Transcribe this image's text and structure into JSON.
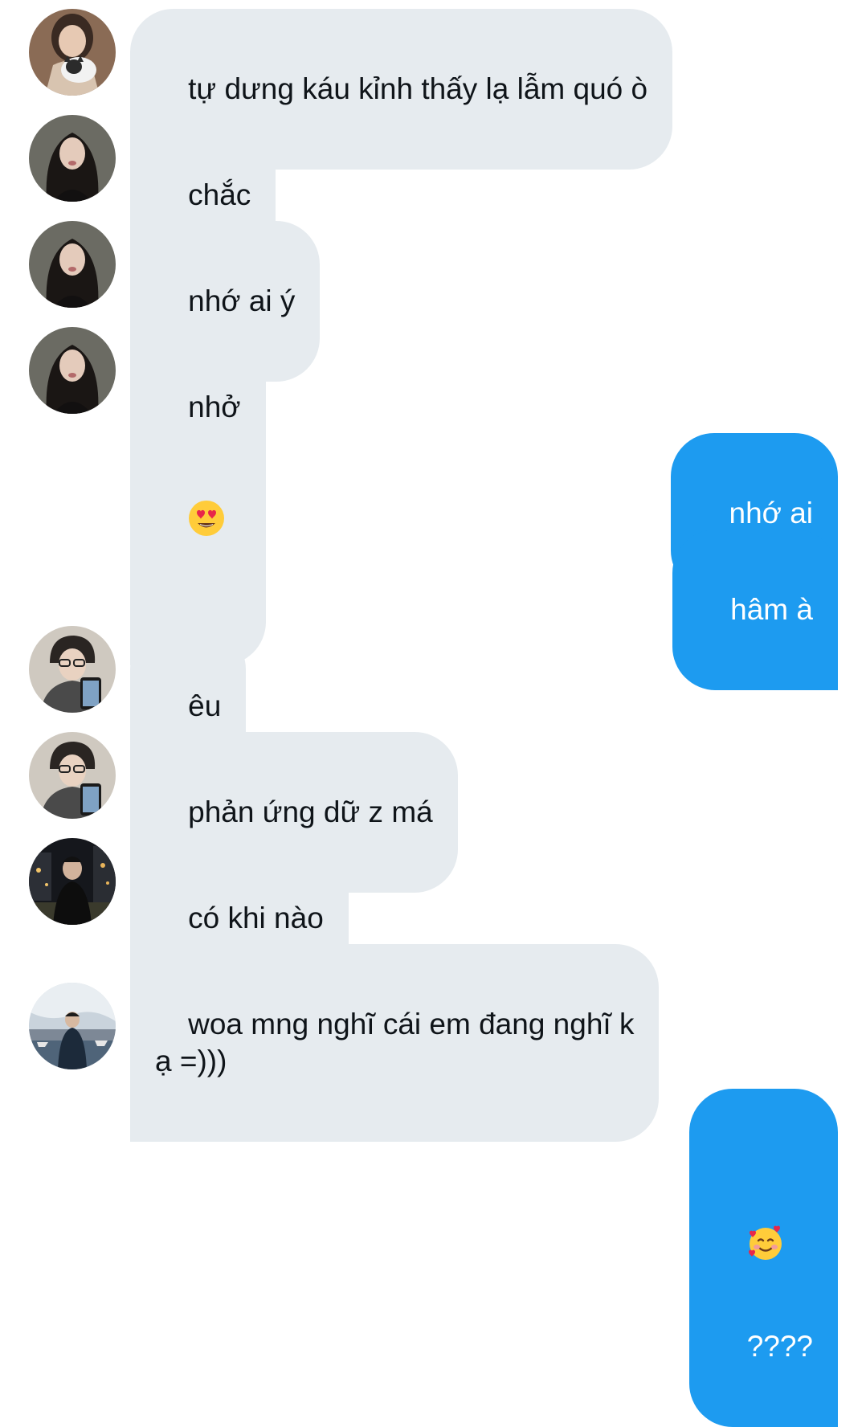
{
  "messages": [
    {
      "side": "in",
      "text": "tự dưng káu kỉnh thấy lạ lẫm quó ò",
      "avatar": "avatar-girl-with-cat"
    },
    {
      "side": "in",
      "text": "chắc",
      "avatar": "avatar-girl-dark-hair"
    },
    {
      "side": "in",
      "text": "nhớ ai ý",
      "avatar": "avatar-girl-dark-hair"
    },
    {
      "side": "in",
      "text": "nhở",
      "emoji": "heart-eyes-emoji",
      "avatar": "avatar-girl-dark-hair"
    },
    {
      "side": "out",
      "text": "nhớ ai"
    },
    {
      "side": "out",
      "text": "hâm à"
    },
    {
      "side": "in",
      "text": "êu",
      "avatar": "avatar-boy-glasses-phone"
    },
    {
      "side": "in",
      "text": "phản ứng dữ z má",
      "avatar": "avatar-boy-glasses-phone"
    },
    {
      "side": "in",
      "text": "có khi nào",
      "avatar": "avatar-boy-night-city"
    },
    {
      "side": "in",
      "text": "woa mng nghĩ cái em đang nghĩ k\nạ =)))",
      "avatar": "avatar-boy-harbor"
    },
    {
      "side": "out",
      "text": "????",
      "emoji": "smiling-face-with-hearts-emoji"
    }
  ],
  "colors": {
    "incoming_bubble": "#e6ebef",
    "incoming_text": "#0f1419",
    "outgoing_bubble": "#1d9bf0",
    "outgoing_text": "#ffffff",
    "background": "#ffffff"
  }
}
